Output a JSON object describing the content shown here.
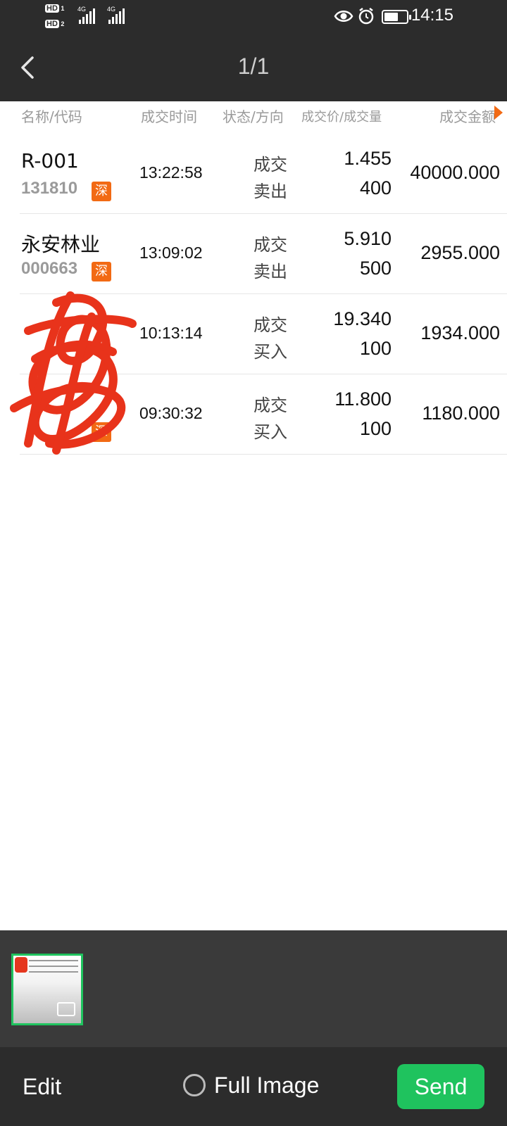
{
  "status_bar": {
    "time": "14:15",
    "network_labels": [
      "4G",
      "4G"
    ],
    "hd_labels": [
      "HD",
      "HD"
    ],
    "icons": [
      "eye-icon",
      "alarm-icon",
      "battery-icon"
    ]
  },
  "header": {
    "back_icon": "chevron-left-icon",
    "title": "1/1"
  },
  "table": {
    "columns": [
      "名称/代码",
      "成交时间",
      "状态/方向",
      "成交价/成交量",
      "成交金额"
    ],
    "rows": [
      {
        "name": "R-001",
        "code": "131810",
        "market": "深",
        "time": "13:22:58",
        "status": "成交",
        "direction": "卖出",
        "price": "1.455",
        "quantity": "400",
        "amount": "40000.000"
      },
      {
        "name": "永安林业",
        "code": "000663",
        "market": "深",
        "time": "13:09:02",
        "status": "成交",
        "direction": "卖出",
        "price": "5.910",
        "quantity": "500",
        "amount": "2955.000"
      },
      {
        "name": "",
        "code": "",
        "market": "",
        "time": "10:13:14",
        "status": "成交",
        "direction": "买入",
        "price": "19.340",
        "quantity": "100",
        "amount": "1934.000"
      },
      {
        "name": "",
        "code": "",
        "market": "深",
        "time": "09:30:32",
        "status": "成交",
        "direction": "买入",
        "price": "11.800",
        "quantity": "100",
        "amount": "1180.000"
      }
    ]
  },
  "bottom": {
    "edit_label": "Edit",
    "full_image_label": "Full Image",
    "send_label": "Send"
  },
  "colors": {
    "dark_bar": "#2c2c2c",
    "accent_green": "#1fc35e",
    "market_orange": "#f26a14",
    "scribble_red": "#e8331b"
  }
}
